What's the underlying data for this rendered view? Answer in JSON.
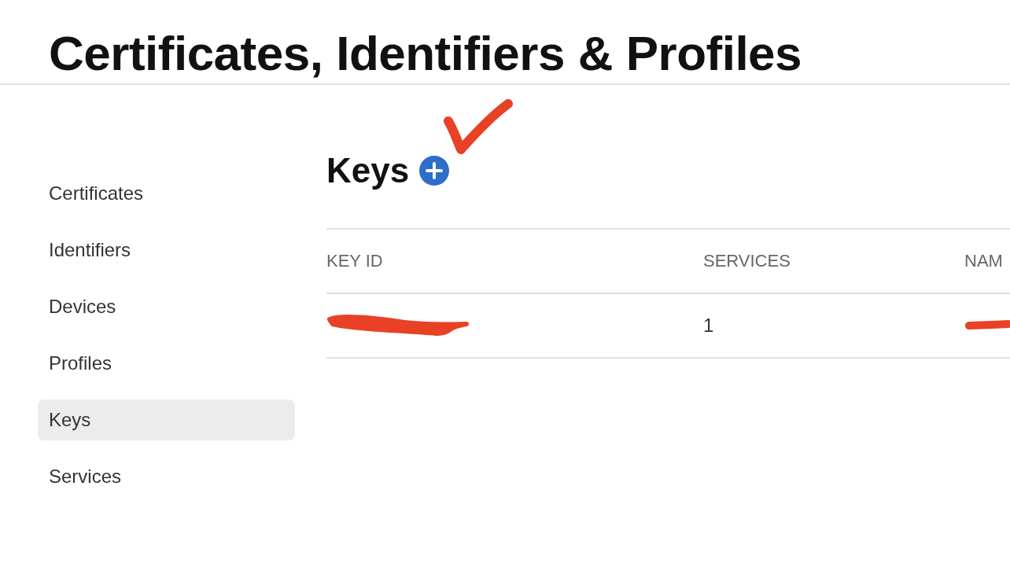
{
  "page_title": "Certificates, Identifiers & Profiles",
  "sidebar": {
    "items": [
      {
        "label": "Certificates",
        "selected": false
      },
      {
        "label": "Identifiers",
        "selected": false
      },
      {
        "label": "Devices",
        "selected": false
      },
      {
        "label": "Profiles",
        "selected": false
      },
      {
        "label": "Keys",
        "selected": true
      },
      {
        "label": "Services",
        "selected": false
      }
    ]
  },
  "section": {
    "title": "Keys"
  },
  "table": {
    "columns": [
      "KEY ID",
      "SERVICES",
      "NAM"
    ],
    "rows": [
      {
        "services": "1"
      }
    ]
  }
}
